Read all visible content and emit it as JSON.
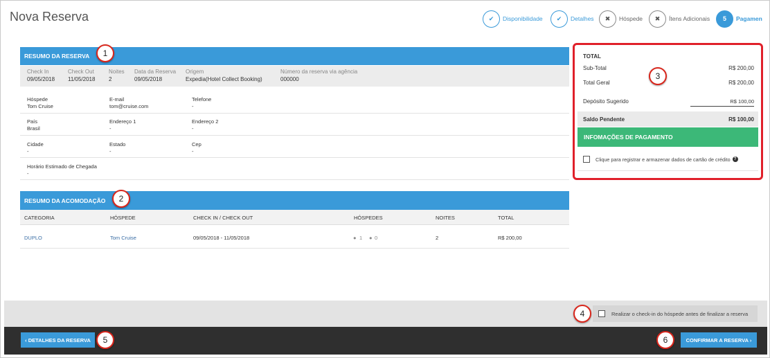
{
  "page_title": "Nova Reserva",
  "stepper": [
    {
      "label": "Disponibilidade",
      "state": "done",
      "mark": "✔"
    },
    {
      "label": "Detalhes",
      "state": "done",
      "mark": "✔"
    },
    {
      "label": "Hóspede",
      "state": "todo",
      "mark": "✖"
    },
    {
      "label": "Ítens Adicionais",
      "state": "todo",
      "mark": "✖"
    },
    {
      "label": "Pagamen",
      "state": "active",
      "mark": "5"
    }
  ],
  "reservation_summary": {
    "title": "RESUMO DA RESERVA",
    "meta": [
      {
        "key": "Check In",
        "value": "09/05/2018"
      },
      {
        "key": "Check Out",
        "value": "11/05/2018"
      },
      {
        "key": "Noites",
        "value": "2"
      },
      {
        "key": "Data da Reserva",
        "value": "09/05/2018"
      },
      {
        "key": "Origem",
        "value": "Expedia(Hotel Collect Booking)"
      },
      {
        "key": "Número da reserva via agência",
        "value": "000000"
      }
    ],
    "fields": {
      "guest": {
        "key": "Hóspede",
        "value": "Tom Cruise"
      },
      "email": {
        "key": "E-mail",
        "value": "tom@cruise.com"
      },
      "phone": {
        "key": "Telefone",
        "value": "-"
      },
      "country": {
        "key": "País",
        "value": "Brasil"
      },
      "address1": {
        "key": "Endereço 1",
        "value": "-"
      },
      "address2": {
        "key": "Endereço 2",
        "value": "-"
      },
      "city": {
        "key": "Cidade",
        "value": "-"
      },
      "state": {
        "key": "Estado",
        "value": "-"
      },
      "zip": {
        "key": "Cep",
        "value": "-"
      },
      "arrival": {
        "key": "Horário Estimado de Chegada",
        "value": "-"
      }
    }
  },
  "accommodation_summary": {
    "title": "RESUMO DA ACOMODAÇÃO",
    "columns": [
      "CATEGORIA",
      "HÓSPEDE",
      "CHECK IN / CHECK OUT",
      "HÓSPEDES",
      "NOITES",
      "TOTAL"
    ],
    "row": {
      "category": "DUPLO",
      "guest": "Tom Cruise",
      "dates": "09/05/2018 - 11/05/2018",
      "adults": "1",
      "children": "0",
      "nights": "2",
      "total": "R$ 200,00"
    }
  },
  "totals": {
    "title": "TOTAL",
    "subtotal_label": "Sub-Total",
    "subtotal_value": "R$ 200,00",
    "grand_label": "Total Geral",
    "grand_value": "R$ 200,00",
    "deposit_label": "Depósito Sugerido",
    "deposit_value": "R$ 100,00",
    "pending_label": "Saldo Pendente",
    "pending_value": "R$ 100,00"
  },
  "payment": {
    "title": "INFOMAÇÕES DE PAGAMENTO",
    "card_checkbox_label": "Clique para registrar e armazenar dados de cartão de crédito",
    "card_checkbox_checked": false
  },
  "checkin_option": {
    "label": "Realizar o check-in do hóspede antes de finalizar a reserva",
    "checked": false
  },
  "buttons": {
    "back": "‹  DETALHES DA RESERVA",
    "confirm": "CONFIRMAR A RESERVA  ›"
  },
  "callouts": [
    "1",
    "2",
    "3",
    "4",
    "5",
    "6"
  ],
  "colors": {
    "primary": "#3a9ad9",
    "payment_header": "#3cb878",
    "highlight_border": "#e0202a",
    "footer_dark": "#2f2f2f"
  }
}
